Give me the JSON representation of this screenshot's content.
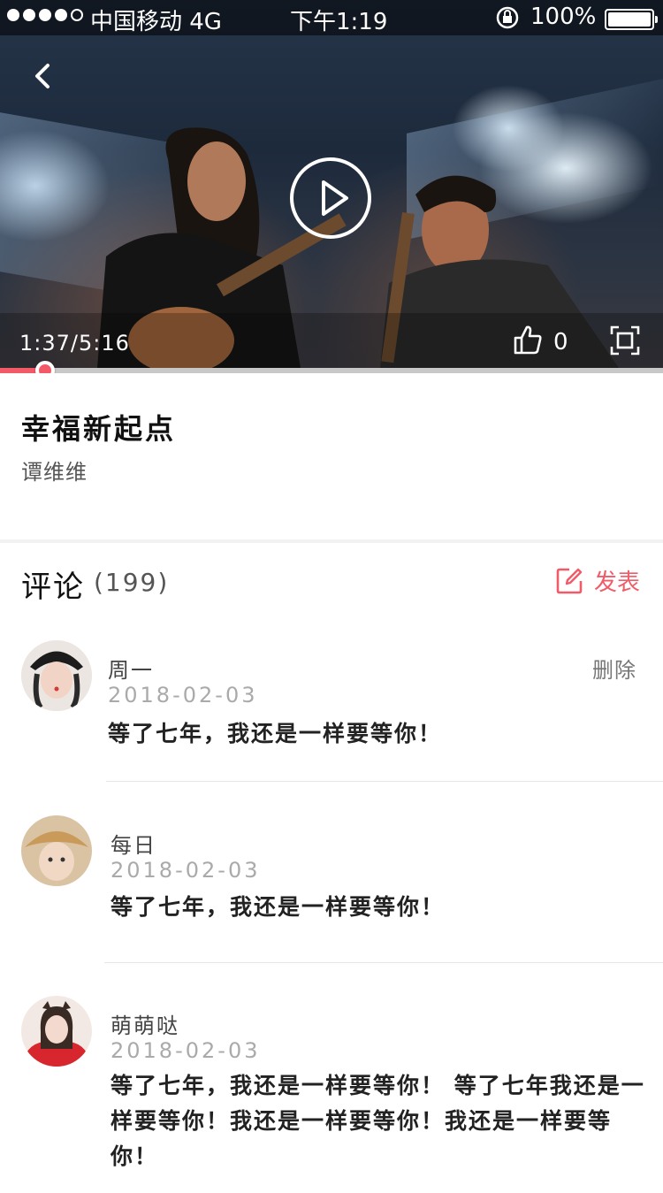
{
  "status_bar": {
    "carrier": "中国移动  4G",
    "time": "下午1:19",
    "battery": "100%"
  },
  "video": {
    "time": "1:37/5:16",
    "like_count": "0",
    "progress": 0.062,
    "accent_color": "#f25a68"
  },
  "song": {
    "title": "幸福新起点",
    "artist": "谭维维"
  },
  "comments": {
    "label": "评论",
    "count": "(199)",
    "post_label": "发表",
    "items": [
      {
        "name": "周一",
        "date": "2018-02-03",
        "text": "等了七年，我还是一样要等你！",
        "delete": "删除"
      },
      {
        "name": "每日",
        "date": "2018-02-03",
        "text": "等了七年，我还是一样要等你！"
      },
      {
        "name": "萌萌哒",
        "date": "2018-02-03",
        "text": "等了七年，我还是一样要等你！ 等了七年我还是一样要等你！我还是一样要等你！我还是一样要等你！"
      }
    ]
  }
}
